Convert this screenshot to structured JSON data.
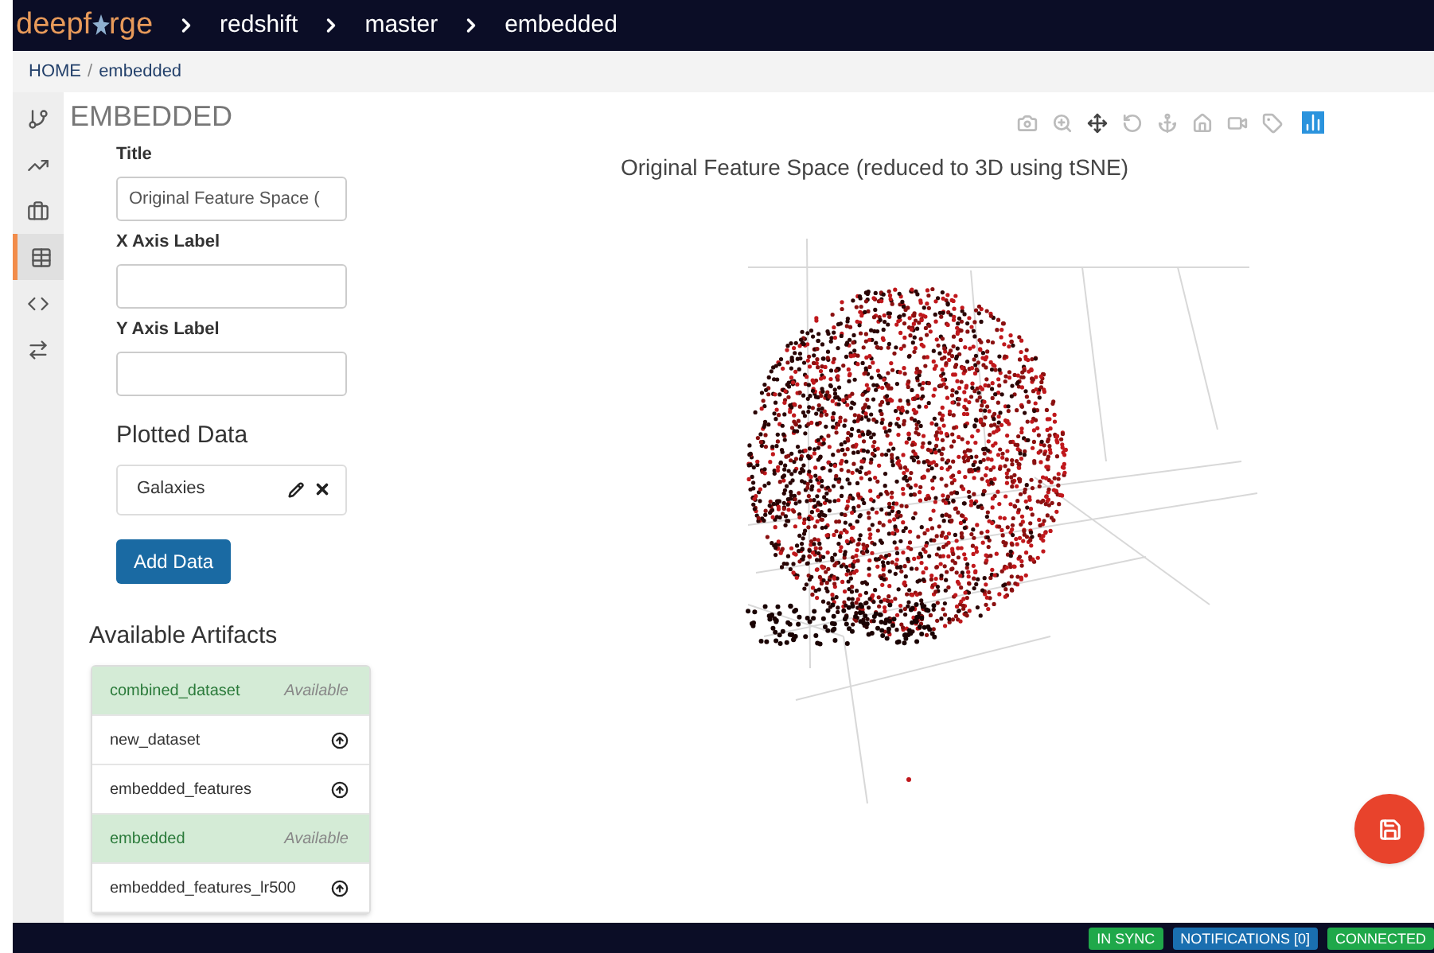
{
  "navbar": {
    "logo": "deepf",
    "logo_rest": "rge",
    "crumbs": [
      "redshift",
      "master",
      "embedded"
    ]
  },
  "breadcrumb": [
    "HOME",
    "embedded"
  ],
  "breadcrumb_separator": "/",
  "sidebar": {
    "items": [
      {
        "kind": "branch",
        "selected": false
      },
      {
        "kind": "chart",
        "selected": false
      },
      {
        "kind": "briefcase",
        "selected": false
      },
      {
        "kind": "table",
        "selected": true
      },
      {
        "kind": "code",
        "selected": false
      },
      {
        "kind": "arrows",
        "selected": false
      }
    ]
  },
  "panel": {
    "title": "EMBEDDED",
    "fields": [
      {
        "label": "Title",
        "value": "Original Feature Space ("
      },
      {
        "label": "X Axis Label"
      },
      {
        "label": "Y Axis Label"
      }
    ],
    "plotted_heading": "Plotted Data",
    "plotted": [
      {
        "name": "Galaxies"
      }
    ],
    "add_button": "Add Data",
    "artifacts_heading": "Available Artifacts",
    "artifacts": [
      {
        "name": "combined_dataset",
        "available": true,
        "status": "Available"
      },
      {
        "name": "new_dataset",
        "available": false
      },
      {
        "name": "embedded_features",
        "available": false
      },
      {
        "name": "embedded",
        "available": true,
        "status": "Available"
      },
      {
        "name": "embedded_features_lr500",
        "available": false
      }
    ]
  },
  "plot": {
    "title": "Original Feature Space (reduced to 3D using tSNE)",
    "toolbar": [
      {
        "kind": "camera",
        "selected": false
      },
      {
        "kind": "zoom",
        "selected": false
      },
      {
        "kind": "pan",
        "selected": true
      },
      {
        "kind": "rotate",
        "selected": false
      },
      {
        "kind": "anchor",
        "selected": false
      },
      {
        "kind": "home",
        "selected": false
      },
      {
        "kind": "video",
        "selected": false
      },
      {
        "kind": "tag",
        "selected": false
      }
    ]
  },
  "status_bar": [
    {
      "label": "IN SYNC",
      "color": "#1fa84a"
    },
    {
      "label": "NOTIFICATIONS [0]",
      "color": "#1a6fb0"
    },
    {
      "label": "CONNECTED",
      "color": "#1fa84a"
    }
  ]
}
